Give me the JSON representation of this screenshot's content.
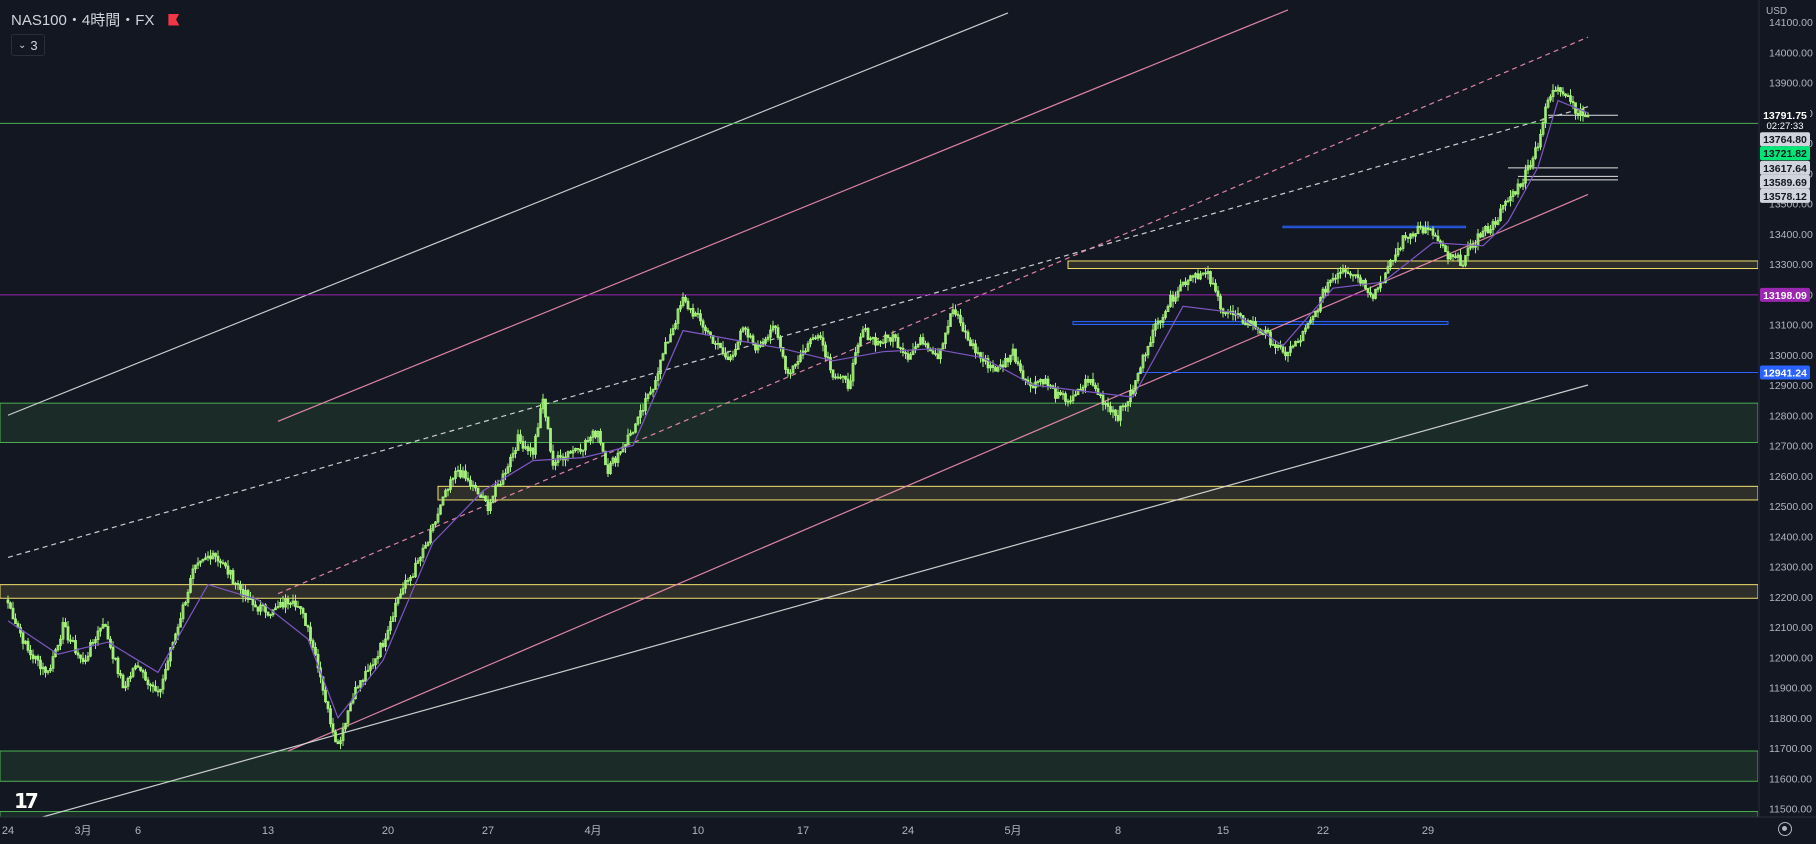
{
  "legend": {
    "title": "NAS100・4時間・FX",
    "indicator_count": "3"
  },
  "price_axis": {
    "currency": "USD",
    "ticks": [
      11500,
      11600,
      11700,
      11800,
      11900,
      12000,
      12100,
      12200,
      12300,
      12400,
      12500,
      12600,
      12700,
      12800,
      12900,
      13000,
      13100,
      13200,
      13300,
      13400,
      13500,
      13600,
      13700,
      13800,
      13900,
      14000,
      14100
    ],
    "tick_labels": [
      "11500.00",
      "11600.00",
      "11700.00",
      "11800.00",
      "11900.00",
      "12000.00",
      "12100.00",
      "12200.00",
      "12300.00",
      "12400.00",
      "12500.00",
      "12600.00",
      "12700.00",
      "12800.00",
      "12900.00",
      "13000.00",
      "13100.00",
      "13200.00",
      "13300.00",
      "13400.00",
      "13500.00",
      "13600.00",
      "13700.00",
      "13800.00",
      "13900.00",
      "14000.00",
      "14100.00"
    ]
  },
  "time_axis": {
    "labels": [
      "24",
      "3月",
      "6",
      "13",
      "20",
      "27",
      "4月",
      "10",
      "17",
      "24",
      "5月",
      "8",
      "15",
      "22",
      "29"
    ]
  },
  "price_labels": [
    {
      "text": "13791.75",
      "sub": "02:27:33",
      "value": 13791.75,
      "bg": "#131722",
      "fg": "#ffffff"
    },
    {
      "text": "13764.80",
      "value": 13764.8,
      "bg": "#d1d4dc",
      "fg": "#131722"
    },
    {
      "text": "13721.82",
      "value": 13721.82,
      "bg": "#00e676",
      "fg": "#131722"
    },
    {
      "text": "13617.64",
      "value": 13617.64,
      "bg": "#d1d4dc",
      "fg": "#131722"
    },
    {
      "text": "13589.69",
      "value": 13589.69,
      "bg": "#d1d4dc",
      "fg": "#131722"
    },
    {
      "text": "13578.12",
      "value": 13578.12,
      "bg": "#d1d4dc",
      "fg": "#131722"
    },
    {
      "text": "13198.09",
      "value": 13198.09,
      "bg": "#9c27b0",
      "fg": "#ffffff"
    },
    {
      "text": "12941.24",
      "value": 12941.24,
      "bg": "#2962ff",
      "fg": "#ffffff"
    }
  ],
  "colors": {
    "background": "#131722",
    "candle": "#a5f07a",
    "ma": "#7e57c2",
    "zone_green": "#4caf50",
    "zone_yellow": "#f3e06d",
    "blue_line": "#2962ff",
    "purple_line": "#9c27b0",
    "channel_pink": "#f48fb1",
    "channel_white": "#e0e0e0",
    "axis_text": "#b2b5be"
  },
  "chart_data": {
    "type": "candlestick",
    "symbol": "NAS100",
    "timeframe": "4時間",
    "exchange": "FX",
    "ylim": [
      11450,
      14150
    ],
    "last_price": 13791.75,
    "countdown": "02:27:33",
    "path": [
      [
        0,
        12180
      ],
      [
        8,
        12020
      ],
      [
        16,
        11950
      ],
      [
        22,
        12100
      ],
      [
        30,
        11980
      ],
      [
        38,
        12120
      ],
      [
        46,
        11900
      ],
      [
        52,
        11980
      ],
      [
        60,
        11870
      ],
      [
        66,
        12050
      ],
      [
        74,
        12280
      ],
      [
        82,
        12350
      ],
      [
        90,
        12260
      ],
      [
        98,
        12170
      ],
      [
        106,
        12150
      ],
      [
        114,
        12200
      ],
      [
        120,
        12100
      ],
      [
        124,
        11980
      ],
      [
        128,
        11820
      ],
      [
        132,
        11710
      ],
      [
        138,
        11880
      ],
      [
        144,
        11950
      ],
      [
        150,
        12050
      ],
      [
        156,
        12200
      ],
      [
        162,
        12280
      ],
      [
        168,
        12380
      ],
      [
        174,
        12520
      ],
      [
        180,
        12620
      ],
      [
        186,
        12560
      ],
      [
        192,
        12500
      ],
      [
        198,
        12600
      ],
      [
        204,
        12720
      ],
      [
        210,
        12680
      ],
      [
        214,
        12850
      ],
      [
        218,
        12640
      ],
      [
        224,
        12680
      ],
      [
        230,
        12700
      ],
      [
        236,
        12750
      ],
      [
        240,
        12620
      ],
      [
        246,
        12700
      ],
      [
        252,
        12780
      ],
      [
        258,
        12900
      ],
      [
        264,
        13050
      ],
      [
        270,
        13180
      ],
      [
        276,
        13120
      ],
      [
        282,
        13050
      ],
      [
        288,
        12980
      ],
      [
        294,
        13080
      ],
      [
        300,
        13020
      ],
      [
        306,
        13100
      ],
      [
        312,
        12940
      ],
      [
        318,
        13010
      ],
      [
        324,
        13080
      ],
      [
        330,
        12940
      ],
      [
        336,
        12900
      ],
      [
        342,
        13080
      ],
      [
        348,
        13040
      ],
      [
        354,
        13060
      ],
      [
        360,
        13000
      ],
      [
        366,
        13050
      ],
      [
        372,
        13000
      ],
      [
        378,
        13150
      ],
      [
        384,
        13050
      ],
      [
        390,
        12980
      ],
      [
        396,
        12950
      ],
      [
        402,
        13010
      ],
      [
        408,
        12900
      ],
      [
        414,
        12920
      ],
      [
        420,
        12860
      ],
      [
        426,
        12850
      ],
      [
        432,
        12920
      ],
      [
        438,
        12850
      ],
      [
        444,
        12800
      ],
      [
        450,
        12880
      ],
      [
        456,
        13040
      ],
      [
        462,
        13140
      ],
      [
        468,
        13220
      ],
      [
        474,
        13270
      ],
      [
        480,
        13260
      ],
      [
        486,
        13150
      ],
      [
        492,
        13120
      ],
      [
        498,
        13100
      ],
      [
        504,
        13060
      ],
      [
        510,
        13000
      ],
      [
        516,
        13040
      ],
      [
        522,
        13120
      ],
      [
        528,
        13240
      ],
      [
        534,
        13290
      ],
      [
        540,
        13260
      ],
      [
        546,
        13200
      ],
      [
        552,
        13280
      ],
      [
        558,
        13380
      ],
      [
        564,
        13420
      ],
      [
        570,
        13400
      ],
      [
        576,
        13320
      ],
      [
        582,
        13310
      ],
      [
        588,
        13390
      ],
      [
        594,
        13430
      ],
      [
        600,
        13510
      ],
      [
        606,
        13580
      ],
      [
        612,
        13700
      ],
      [
        616,
        13840
      ],
      [
        620,
        13890
      ],
      [
        624,
        13860
      ],
      [
        628,
        13800
      ],
      [
        632,
        13790
      ]
    ],
    "ma_series": [
      [
        0,
        12120
      ],
      [
        20,
        12010
      ],
      [
        40,
        12050
      ],
      [
        60,
        11950
      ],
      [
        80,
        12240
      ],
      [
        100,
        12190
      ],
      [
        120,
        12060
      ],
      [
        132,
        11800
      ],
      [
        150,
        11990
      ],
      [
        170,
        12380
      ],
      [
        190,
        12550
      ],
      [
        210,
        12650
      ],
      [
        230,
        12660
      ],
      [
        250,
        12700
      ],
      [
        270,
        13080
      ],
      [
        290,
        13050
      ],
      [
        310,
        13020
      ],
      [
        330,
        12980
      ],
      [
        350,
        13010
      ],
      [
        370,
        13020
      ],
      [
        390,
        12990
      ],
      [
        410,
        12900
      ],
      [
        430,
        12880
      ],
      [
        450,
        12860
      ],
      [
        470,
        13160
      ],
      [
        490,
        13140
      ],
      [
        510,
        13030
      ],
      [
        530,
        13220
      ],
      [
        550,
        13240
      ],
      [
        570,
        13370
      ],
      [
        590,
        13360
      ],
      [
        600,
        13440
      ],
      [
        612,
        13620
      ],
      [
        620,
        13840
      ],
      [
        632,
        13800
      ]
    ],
    "horizontal_levels": [
      {
        "price": 13764.8,
        "color": "#4caf50"
      },
      {
        "price": 13198.09,
        "color": "#9c27b0"
      },
      {
        "price": 12941.24,
        "color": "#2962ff",
        "from_bar": 452
      },
      {
        "price": 13791.75,
        "color": "#e0e0e0",
        "from_bar": 616,
        "to_bar": 644
      },
      {
        "price": 13617.64,
        "color": "#e0e0e0",
        "from_bar": 600,
        "to_bar": 644
      },
      {
        "price": 13589.69,
        "color": "#e0e0e0",
        "from_bar": 604,
        "to_bar": 644
      },
      {
        "price": 13578.12,
        "color": "#e0e0e0",
        "from_bar": 606,
        "to_bar": 644
      }
    ],
    "zones": [
      {
        "top": 12840,
        "bottom": 12710,
        "color": "#4caf50"
      },
      {
        "top": 12240,
        "bottom": 12195,
        "color": "#f3e06d"
      },
      {
        "top": 11690,
        "bottom": 11590,
        "color": "#4caf50"
      },
      {
        "top": 11490,
        "bottom": 11450,
        "color": "#4caf50"
      },
      {
        "top": 12565,
        "bottom": 12520,
        "color": "#f3e06d",
        "from_bar": 172
      },
      {
        "top": 13310,
        "bottom": 13285,
        "color": "#f3e06d",
        "from_bar": 424
      },
      {
        "top": 13110,
        "bottom": 13100,
        "color": "#2962ff",
        "from_bar": 426,
        "to_bar": 576
      },
      {
        "top": 13425,
        "bottom": 13420,
        "color": "#2962ff",
        "from_bar": 510,
        "to_bar": 583
      }
    ],
    "trendlines": [
      {
        "p1": [
          0,
          12800
        ],
        "p2": [
          400,
          14130
        ],
        "color": "#e0e0e0",
        "style": "solid"
      },
      {
        "p1": [
          108,
          12780
        ],
        "p2": [
          512,
          14140
        ],
        "color": "#f48fb1",
        "style": "solid"
      },
      {
        "p1": [
          0,
          12330
        ],
        "p2": [
          632,
          13820
        ],
        "color": "#e0e0e0",
        "style": "dashed"
      },
      {
        "p1": [
          108,
          12210
        ],
        "p2": [
          632,
          14050
        ],
        "color": "#f48fb1",
        "style": "dashed"
      },
      {
        "p1": [
          112,
          11690
        ],
        "p2": [
          632,
          13530
        ],
        "color": "#f48fb1",
        "style": "solid"
      },
      {
        "p1": [
          0,
          11440
        ],
        "p2": [
          632,
          12900
        ],
        "color": "#e0e0e0",
        "style": "solid"
      }
    ]
  }
}
